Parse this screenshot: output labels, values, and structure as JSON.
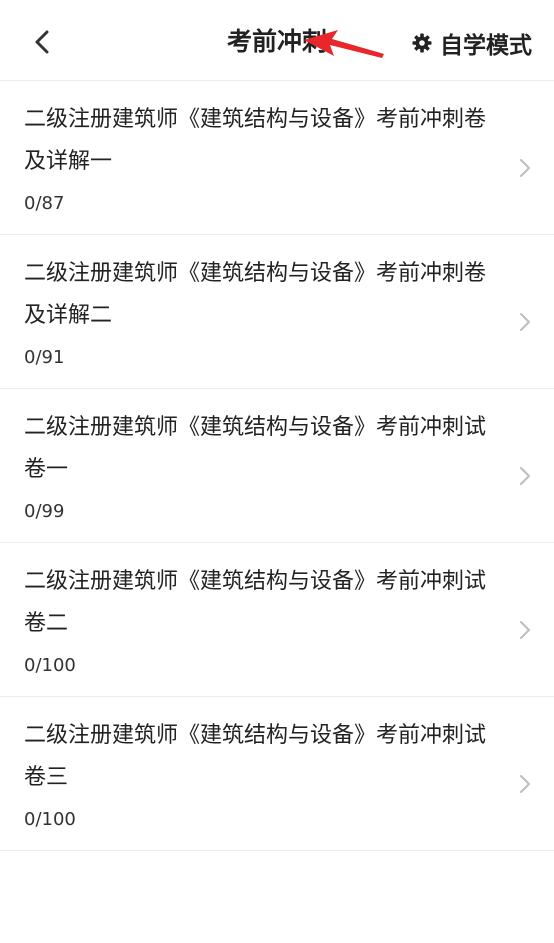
{
  "header": {
    "title": "考前冲刺",
    "mode_label": "自学模式",
    "icons": {
      "back": "back-chevron-icon",
      "settings": "gear-icon",
      "annotation": "red-arrow-annotation"
    },
    "accent_color": "#e8262b"
  },
  "items": [
    {
      "title": "二级注册建筑师《建筑结构与设备》考前冲刺卷及详解一",
      "count": "0/87"
    },
    {
      "title": "二级注册建筑师《建筑结构与设备》考前冲刺卷及详解二",
      "count": "0/91"
    },
    {
      "title": "二级注册建筑师《建筑结构与设备》考前冲刺试卷一",
      "count": "0/99"
    },
    {
      "title": "二级注册建筑师《建筑结构与设备》考前冲刺试卷二",
      "count": "0/100"
    },
    {
      "title": "二级注册建筑师《建筑结构与设备》考前冲刺试卷三",
      "count": "0/100"
    }
  ]
}
